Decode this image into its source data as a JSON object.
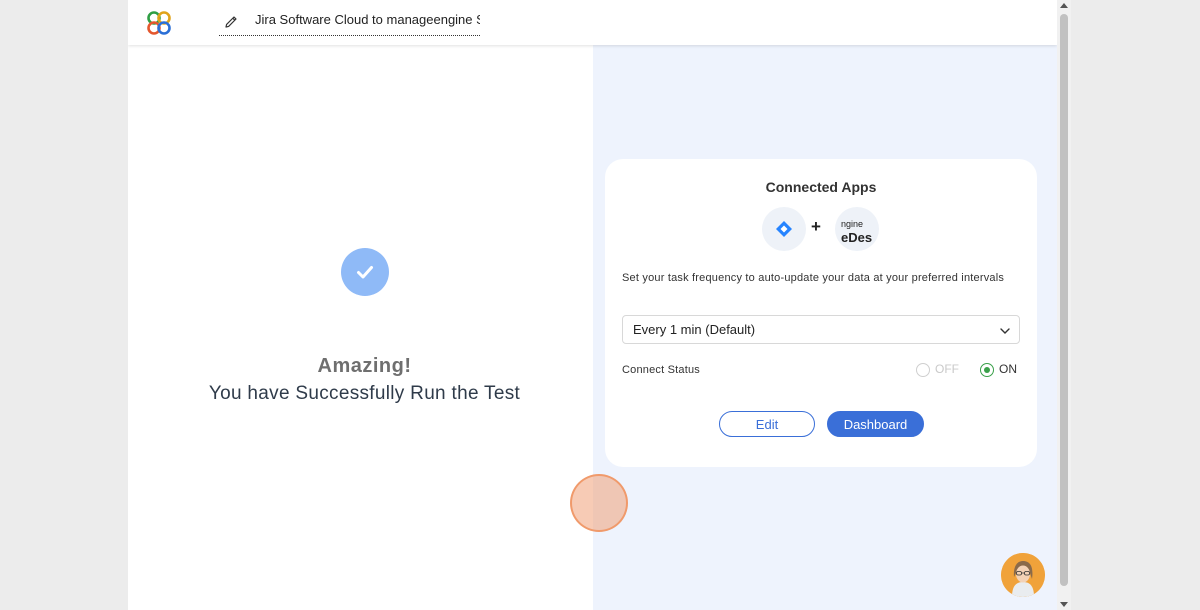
{
  "header": {
    "workflow_title": "Jira Software Cloud to manageengine ServiceDesk",
    "logo_icon": "app-logo-icon",
    "edit_icon": "pencil-icon"
  },
  "left_panel": {
    "heading": "Amazing!",
    "message": "You have Successfully Run the Test",
    "status_icon": "check-circle-icon"
  },
  "connected_apps": {
    "title": "Connected Apps",
    "apps": [
      {
        "name": "Jira Software Cloud",
        "icon": "jira-icon"
      },
      {
        "name": "ManageEngine ServiceDesk",
        "icon": "servicedesk-icon",
        "visible_text_top": "ngine",
        "visible_text_main": "eDes"
      }
    ],
    "plus": "+",
    "frequency_text": "Set your task frequency to auto-update your data at your preferred intervals",
    "frequency_selected": "Every 1 min (Default)",
    "status_label": "Connect Status",
    "status_off_label": "OFF",
    "status_on_label": "ON",
    "status_selected": "ON",
    "edit_button": "Edit",
    "dashboard_button": "Dashboard"
  },
  "colors": {
    "accent": "#3a6fd8",
    "right_panel_bg": "#eef3fd",
    "check_circle": "#8fbaf7",
    "on_radio": "#3aa04a"
  }
}
